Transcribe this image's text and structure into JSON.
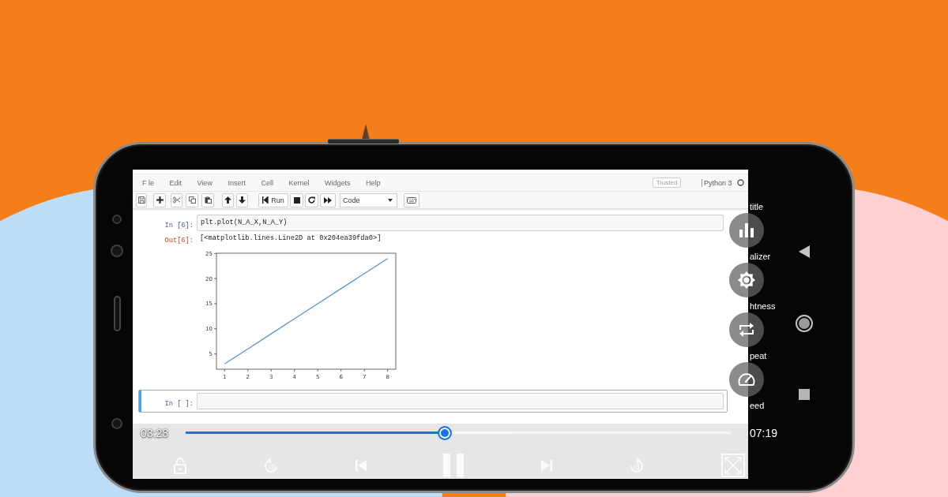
{
  "notebook": {
    "menu": [
      "F le",
      "Edit",
      "View",
      "Insert",
      "Cell",
      "Kernel",
      "Widgets",
      "Help"
    ],
    "trusted": "Trusted",
    "kernel": {
      "name": "Python 3",
      "busy": false
    },
    "toolbar": {
      "run_label": "Run",
      "cell_type": "Code"
    },
    "cells": [
      {
        "prompt": "In [6]:",
        "source": "plt.plot(N_A_X,N_A_Y)",
        "selected": false,
        "outputs": [
          {
            "kind": "text",
            "prompt": "Out[6]:",
            "text": "[<matplotlib.lines.Line2D at 0x204ea39fda0>]"
          },
          {
            "kind": "chart",
            "chart_data": {
              "type": "line",
              "x": [
                1,
                2,
                3,
                4,
                5,
                6,
                7,
                8
              ],
              "values": [
                3,
                6,
                9,
                12,
                15,
                18,
                21,
                24
              ],
              "xlim": [
                0.65,
                8.35
              ],
              "ylim": [
                1.95,
                25.05
              ],
              "xticks": [
                1,
                2,
                3,
                4,
                5,
                6,
                7,
                8
              ],
              "yticks": [
                5,
                10,
                15,
                20,
                25
              ]
            }
          }
        ]
      },
      {
        "prompt": "In [ ]:",
        "selected": true
      }
    ]
  },
  "player": {
    "elapsed": "03:28",
    "duration": "07:19",
    "level": 0.475,
    "buffer": {
      "level": 0.6
    },
    "playing": true,
    "options": [
      {
        "kind": "subtitle",
        "label": "title"
      },
      {
        "kind": "equalizer",
        "label": "alizer"
      },
      {
        "kind": "brightness",
        "label": "htness"
      },
      {
        "kind": "repeat",
        "label": "peat"
      },
      {
        "kind": "speed",
        "label": "eed"
      }
    ]
  }
}
